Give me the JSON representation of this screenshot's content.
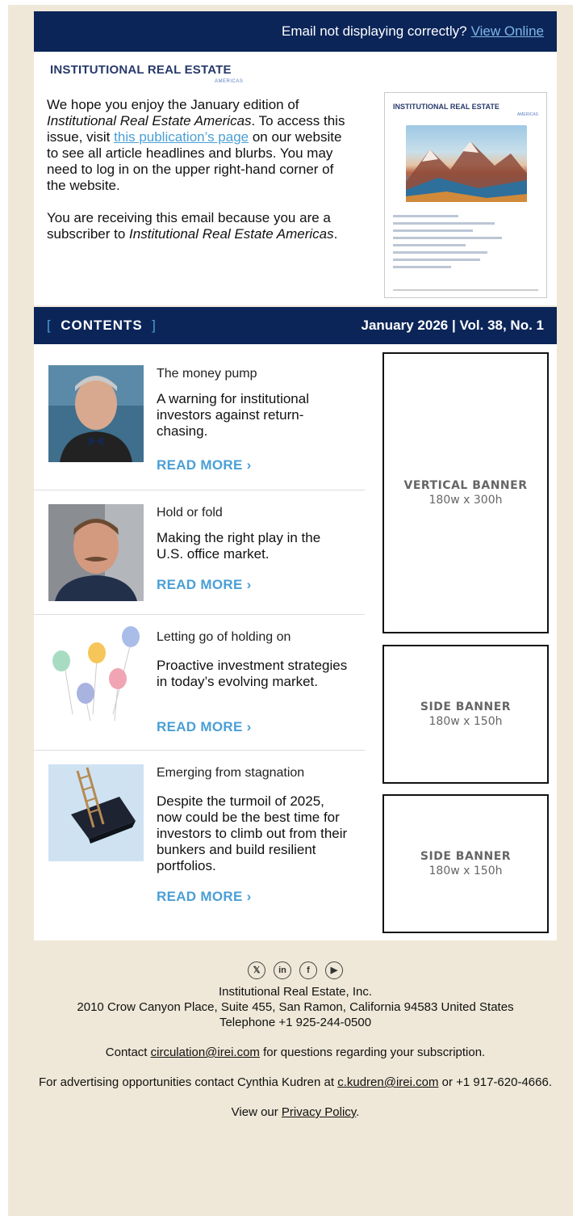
{
  "topbar": {
    "text": "Email not displaying correctly?",
    "link": "View Online"
  },
  "logo": {
    "main": "INSTITUTIONAL REAL ESTATE",
    "sub": "AMERICAS"
  },
  "intro": {
    "p1_a": "We hope you enjoy the January edition of ",
    "p1_em": "Institutional Real Estate Americas",
    "p1_b": ". To access this issue, visit ",
    "p1_link": "this publication’s page",
    "p1_c": " on our website to see all article headlines and blurbs. You may need to log in on the upper right-hand corner of the website.",
    "p2_a": "You are receiving this email because you are a subscriber to ",
    "p2_em": "Institutional Real Estate Americas",
    "p2_b": "."
  },
  "cover": {
    "title": "INSTITUTIONAL REAL ESTATE",
    "sub": "AMERICAS"
  },
  "contents": {
    "bracket_open": "[",
    "label": "CONTENTS",
    "bracket_close": "]",
    "issue": "January 2026 | Vol. 38, No. 1"
  },
  "articles": [
    {
      "title": "The money pump",
      "desc": "A warning for institutional investors against return-chasing.",
      "more": "READ MORE ›"
    },
    {
      "title": "Hold or fold",
      "desc": "Making the right play in the U.S. office market.",
      "more": "READ MORE ›"
    },
    {
      "title": "Letting go of holding on",
      "desc": "Proactive investment strategies in today’s evolving market.",
      "more": "READ MORE ›"
    },
    {
      "title": "Emerging from stagnation",
      "desc": "Despite the turmoil of 2025, now could be the best time for investors to climb out from their bunkers and build resilient portfolios.",
      "more": "READ MORE ›"
    }
  ],
  "banners": [
    {
      "name": "VERTICAL BANNER",
      "size": "180w x 300h"
    },
    {
      "name": "SIDE BANNER",
      "size": "180w x 150h"
    },
    {
      "name": "SIDE BANNER",
      "size": "180w x 150h"
    }
  ],
  "footer": {
    "company": "Institutional Real Estate, Inc.",
    "address": "2010 Crow Canyon Place, Suite 455, San Ramon, California 94583 United States",
    "phone": "Telephone +1 925-244-0500",
    "contact_a": "Contact ",
    "contact_email": "circulation@irei.com",
    "contact_b": " for questions regarding your subscription.",
    "ad_a": "For advertising opportunities contact Cynthia Kudren at ",
    "ad_email": "c.kudren@irei.com",
    "ad_b": " or +1 917-620-4666.",
    "privacy_a": "View our ",
    "privacy_link": "Privacy Policy",
    "privacy_b": "."
  },
  "social": [
    "x-icon",
    "linkedin-icon",
    "facebook-icon",
    "youtube-icon"
  ]
}
